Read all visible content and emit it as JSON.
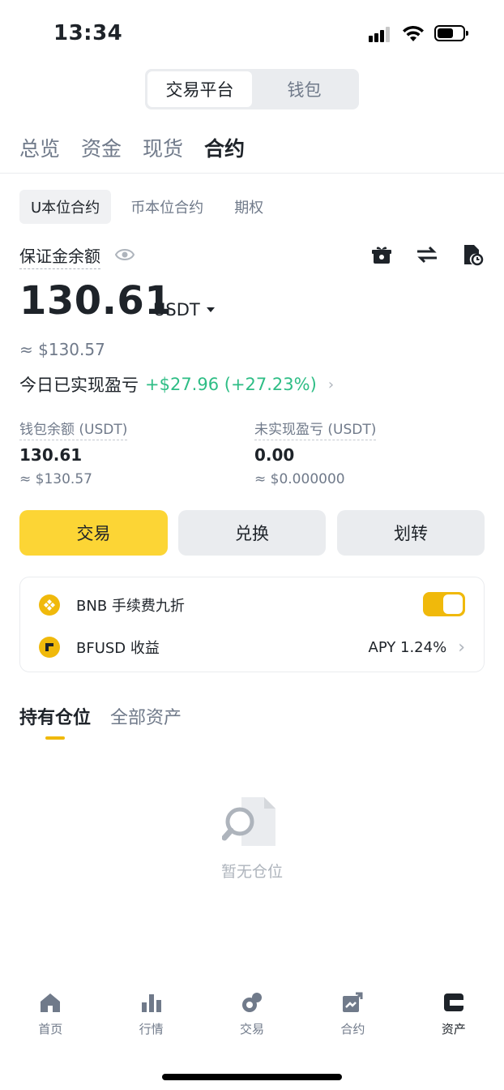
{
  "status_bar": {
    "time": "13:34"
  },
  "segment": {
    "items": [
      "交易平台",
      "钱包"
    ]
  },
  "top_tabs": [
    "总览",
    "资金",
    "现货",
    "合约"
  ],
  "sub_tabs": [
    "U本位合约",
    "币本位合约",
    "期权"
  ],
  "margin": {
    "label": "保证金余额",
    "amount": "130.61",
    "unit": "USDT",
    "approx": "≈ $130.57",
    "pnl_label": "今日已实现盈亏",
    "pnl_value": "+$27.96 (+27.23%)"
  },
  "stats": {
    "wallet": {
      "label": "钱包余额 (USDT)",
      "value": "130.61",
      "approx": "≈ $130.57"
    },
    "unrealized": {
      "label": "未实现盈亏 (USDT)",
      "value": "0.00",
      "approx": "≈ $0.000000"
    }
  },
  "actions": {
    "trade": "交易",
    "convert": "兑换",
    "transfer": "划转"
  },
  "card": {
    "bnb_label": "BNB 手续费九折",
    "bnb_toggle_on": true,
    "bfusd_label": "BFUSD 收益",
    "bfusd_apy": "APY 1.24%"
  },
  "position_tabs": [
    "持有仓位",
    "全部资产"
  ],
  "empty_text": "暂无仓位",
  "nav": [
    "首页",
    "行情",
    "交易",
    "合约",
    "资产"
  ],
  "colors": {
    "accent": "#fcd535",
    "positive": "#2ebd85",
    "toggle": "#f0b90b"
  }
}
